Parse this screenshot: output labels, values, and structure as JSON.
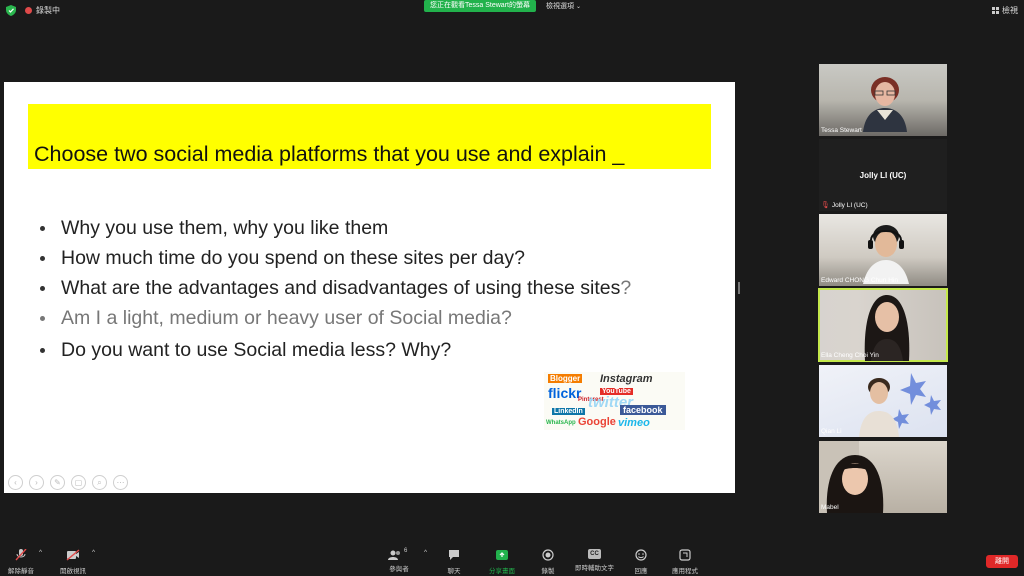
{
  "topbar": {
    "recording": "錄製中",
    "viewing_banner": "您正在觀看Tessa Stewart的螢幕",
    "view_options": "檢視選項",
    "layout": "檢視"
  },
  "slide": {
    "title": "Choose two social media platforms that you use and explain _",
    "bullets": [
      {
        "text": "Why you use them, why you like them"
      },
      {
        "text": "How much time do you spend on these sites per day?"
      },
      {
        "text": "What are the advantages and disadvantages of using these sites",
        "suffix": "?"
      },
      {
        "text": "Am I a light, medium or heavy user of Social media?"
      },
      {
        "text": "Do you want to use Social media less? Why?"
      }
    ],
    "collage": [
      "Blogger",
      "Instagram",
      "flickr",
      "YouTube",
      "twitter",
      "LinkedIn",
      "facebook",
      "WhatsApp",
      "Google",
      "vimeo",
      "Pinterest"
    ]
  },
  "participants": [
    {
      "name": "Tessa Stewart"
    },
    {
      "name": "Jolly LI (UC)",
      "display": "Jolly LI (UC)"
    },
    {
      "name": "Edward CHONG Chun Hin"
    },
    {
      "name": "Ella Cheng Choi Yin"
    },
    {
      "name": "Qian Li"
    },
    {
      "name": "Mabel"
    }
  ],
  "toolbar": {
    "unmute": "解除靜音",
    "start_video": "開啟視訊",
    "participants": "參與者",
    "participants_count": "6",
    "chat": "聊天",
    "share_screen": "分享畫面",
    "record": "錄製",
    "live_transcript": "即時輔助文字",
    "cc": "CC",
    "reactions": "回應",
    "apps": "應用程式",
    "end": "離開"
  },
  "colors": {
    "accent_green": "#22b24c",
    "highlight_yellow": "#ffff00",
    "end_red": "#e02828",
    "active_speaker": "#c4e84b"
  }
}
